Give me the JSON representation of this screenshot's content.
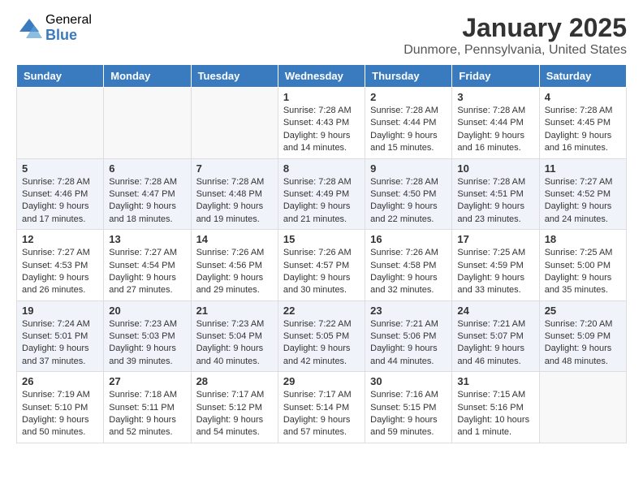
{
  "logo": {
    "general": "General",
    "blue": "Blue"
  },
  "header": {
    "month": "January 2025",
    "location": "Dunmore, Pennsylvania, United States"
  },
  "days": [
    "Sunday",
    "Monday",
    "Tuesday",
    "Wednesday",
    "Thursday",
    "Friday",
    "Saturday"
  ],
  "weeks": [
    {
      "alt": false,
      "cells": [
        {
          "day": "",
          "empty": true,
          "lines": []
        },
        {
          "day": "",
          "empty": true,
          "lines": []
        },
        {
          "day": "",
          "empty": true,
          "lines": []
        },
        {
          "day": "1",
          "empty": false,
          "lines": [
            "Sunrise: 7:28 AM",
            "Sunset: 4:43 PM",
            "Daylight: 9 hours",
            "and 14 minutes."
          ]
        },
        {
          "day": "2",
          "empty": false,
          "lines": [
            "Sunrise: 7:28 AM",
            "Sunset: 4:44 PM",
            "Daylight: 9 hours",
            "and 15 minutes."
          ]
        },
        {
          "day": "3",
          "empty": false,
          "lines": [
            "Sunrise: 7:28 AM",
            "Sunset: 4:44 PM",
            "Daylight: 9 hours",
            "and 16 minutes."
          ]
        },
        {
          "day": "4",
          "empty": false,
          "lines": [
            "Sunrise: 7:28 AM",
            "Sunset: 4:45 PM",
            "Daylight: 9 hours",
            "and 16 minutes."
          ]
        }
      ]
    },
    {
      "alt": true,
      "cells": [
        {
          "day": "5",
          "empty": false,
          "lines": [
            "Sunrise: 7:28 AM",
            "Sunset: 4:46 PM",
            "Daylight: 9 hours",
            "and 17 minutes."
          ]
        },
        {
          "day": "6",
          "empty": false,
          "lines": [
            "Sunrise: 7:28 AM",
            "Sunset: 4:47 PM",
            "Daylight: 9 hours",
            "and 18 minutes."
          ]
        },
        {
          "day": "7",
          "empty": false,
          "lines": [
            "Sunrise: 7:28 AM",
            "Sunset: 4:48 PM",
            "Daylight: 9 hours",
            "and 19 minutes."
          ]
        },
        {
          "day": "8",
          "empty": false,
          "lines": [
            "Sunrise: 7:28 AM",
            "Sunset: 4:49 PM",
            "Daylight: 9 hours",
            "and 21 minutes."
          ]
        },
        {
          "day": "9",
          "empty": false,
          "lines": [
            "Sunrise: 7:28 AM",
            "Sunset: 4:50 PM",
            "Daylight: 9 hours",
            "and 22 minutes."
          ]
        },
        {
          "day": "10",
          "empty": false,
          "lines": [
            "Sunrise: 7:28 AM",
            "Sunset: 4:51 PM",
            "Daylight: 9 hours",
            "and 23 minutes."
          ]
        },
        {
          "day": "11",
          "empty": false,
          "lines": [
            "Sunrise: 7:27 AM",
            "Sunset: 4:52 PM",
            "Daylight: 9 hours",
            "and 24 minutes."
          ]
        }
      ]
    },
    {
      "alt": false,
      "cells": [
        {
          "day": "12",
          "empty": false,
          "lines": [
            "Sunrise: 7:27 AM",
            "Sunset: 4:53 PM",
            "Daylight: 9 hours",
            "and 26 minutes."
          ]
        },
        {
          "day": "13",
          "empty": false,
          "lines": [
            "Sunrise: 7:27 AM",
            "Sunset: 4:54 PM",
            "Daylight: 9 hours",
            "and 27 minutes."
          ]
        },
        {
          "day": "14",
          "empty": false,
          "lines": [
            "Sunrise: 7:26 AM",
            "Sunset: 4:56 PM",
            "Daylight: 9 hours",
            "and 29 minutes."
          ]
        },
        {
          "day": "15",
          "empty": false,
          "lines": [
            "Sunrise: 7:26 AM",
            "Sunset: 4:57 PM",
            "Daylight: 9 hours",
            "and 30 minutes."
          ]
        },
        {
          "day": "16",
          "empty": false,
          "lines": [
            "Sunrise: 7:26 AM",
            "Sunset: 4:58 PM",
            "Daylight: 9 hours",
            "and 32 minutes."
          ]
        },
        {
          "day": "17",
          "empty": false,
          "lines": [
            "Sunrise: 7:25 AM",
            "Sunset: 4:59 PM",
            "Daylight: 9 hours",
            "and 33 minutes."
          ]
        },
        {
          "day": "18",
          "empty": false,
          "lines": [
            "Sunrise: 7:25 AM",
            "Sunset: 5:00 PM",
            "Daylight: 9 hours",
            "and 35 minutes."
          ]
        }
      ]
    },
    {
      "alt": true,
      "cells": [
        {
          "day": "19",
          "empty": false,
          "lines": [
            "Sunrise: 7:24 AM",
            "Sunset: 5:01 PM",
            "Daylight: 9 hours",
            "and 37 minutes."
          ]
        },
        {
          "day": "20",
          "empty": false,
          "lines": [
            "Sunrise: 7:23 AM",
            "Sunset: 5:03 PM",
            "Daylight: 9 hours",
            "and 39 minutes."
          ]
        },
        {
          "day": "21",
          "empty": false,
          "lines": [
            "Sunrise: 7:23 AM",
            "Sunset: 5:04 PM",
            "Daylight: 9 hours",
            "and 40 minutes."
          ]
        },
        {
          "day": "22",
          "empty": false,
          "lines": [
            "Sunrise: 7:22 AM",
            "Sunset: 5:05 PM",
            "Daylight: 9 hours",
            "and 42 minutes."
          ]
        },
        {
          "day": "23",
          "empty": false,
          "lines": [
            "Sunrise: 7:21 AM",
            "Sunset: 5:06 PM",
            "Daylight: 9 hours",
            "and 44 minutes."
          ]
        },
        {
          "day": "24",
          "empty": false,
          "lines": [
            "Sunrise: 7:21 AM",
            "Sunset: 5:07 PM",
            "Daylight: 9 hours",
            "and 46 minutes."
          ]
        },
        {
          "day": "25",
          "empty": false,
          "lines": [
            "Sunrise: 7:20 AM",
            "Sunset: 5:09 PM",
            "Daylight: 9 hours",
            "and 48 minutes."
          ]
        }
      ]
    },
    {
      "alt": false,
      "cells": [
        {
          "day": "26",
          "empty": false,
          "lines": [
            "Sunrise: 7:19 AM",
            "Sunset: 5:10 PM",
            "Daylight: 9 hours",
            "and 50 minutes."
          ]
        },
        {
          "day": "27",
          "empty": false,
          "lines": [
            "Sunrise: 7:18 AM",
            "Sunset: 5:11 PM",
            "Daylight: 9 hours",
            "and 52 minutes."
          ]
        },
        {
          "day": "28",
          "empty": false,
          "lines": [
            "Sunrise: 7:17 AM",
            "Sunset: 5:12 PM",
            "Daylight: 9 hours",
            "and 54 minutes."
          ]
        },
        {
          "day": "29",
          "empty": false,
          "lines": [
            "Sunrise: 7:17 AM",
            "Sunset: 5:14 PM",
            "Daylight: 9 hours",
            "and 57 minutes."
          ]
        },
        {
          "day": "30",
          "empty": false,
          "lines": [
            "Sunrise: 7:16 AM",
            "Sunset: 5:15 PM",
            "Daylight: 9 hours",
            "and 59 minutes."
          ]
        },
        {
          "day": "31",
          "empty": false,
          "lines": [
            "Sunrise: 7:15 AM",
            "Sunset: 5:16 PM",
            "Daylight: 10 hours",
            "and 1 minute."
          ]
        },
        {
          "day": "",
          "empty": true,
          "lines": []
        }
      ]
    }
  ]
}
